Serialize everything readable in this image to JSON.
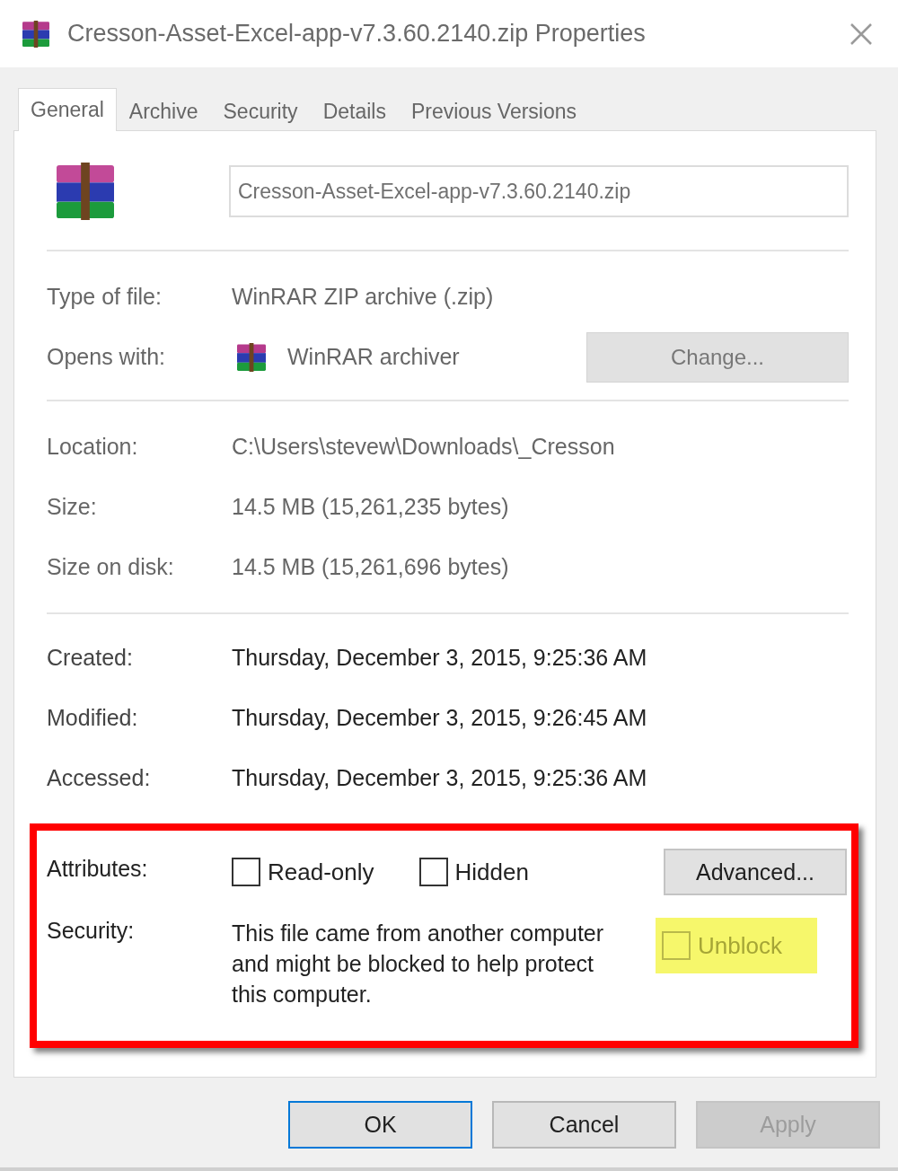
{
  "window": {
    "title": "Cresson-Asset-Excel-app-v7.3.60.2140.zip Properties"
  },
  "tabs": [
    {
      "label": "General",
      "selected": true
    },
    {
      "label": "Archive",
      "selected": false
    },
    {
      "label": "Security",
      "selected": false
    },
    {
      "label": "Details",
      "selected": false
    },
    {
      "label": "Previous Versions",
      "selected": false
    }
  ],
  "general": {
    "file_name": "Cresson-Asset-Excel-app-v7.3.60.2140.zip",
    "type_rows": [
      {
        "label": "Type of file:",
        "value": "WinRAR ZIP archive (.zip)"
      }
    ],
    "opens_with": {
      "label": "Opens with:",
      "value": "WinRAR archiver",
      "button": "Change..."
    },
    "location_rows": [
      {
        "label": "Location:",
        "value": "C:\\Users\\stevew\\Downloads\\_Cresson"
      },
      {
        "label": "Size:",
        "value": "14.5 MB (15,261,235 bytes)"
      },
      {
        "label": "Size on disk:",
        "value": "14.5 MB (15,261,696 bytes)"
      }
    ],
    "date_rows": [
      {
        "label": "Created:",
        "value": "Thursday, December 3, 2015, 9:25:36 AM"
      },
      {
        "label": "Modified:",
        "value": "Thursday, December 3, 2015, 9:26:45 AM"
      },
      {
        "label": "Accessed:",
        "value": "Thursday, December 3, 2015, 9:25:36 AM"
      }
    ],
    "security_section": {
      "highlighted": true,
      "attributes": {
        "label": "Attributes:",
        "checkboxes": [
          {
            "label": "Read-only",
            "checked": false
          },
          {
            "label": "Hidden",
            "checked": false
          }
        ],
        "button": "Advanced..."
      },
      "security": {
        "label": "Security:",
        "text": "This file came from another computer and might be blocked to help protect this computer.",
        "unblock": {
          "label": "Unblock",
          "checked": false,
          "highlighted": true
        }
      }
    }
  },
  "buttons": [
    {
      "label": "OK",
      "default": true,
      "disabled": false
    },
    {
      "label": "Cancel",
      "default": false,
      "disabled": false
    },
    {
      "label": "Apply",
      "default": false,
      "disabled": true
    }
  ]
}
